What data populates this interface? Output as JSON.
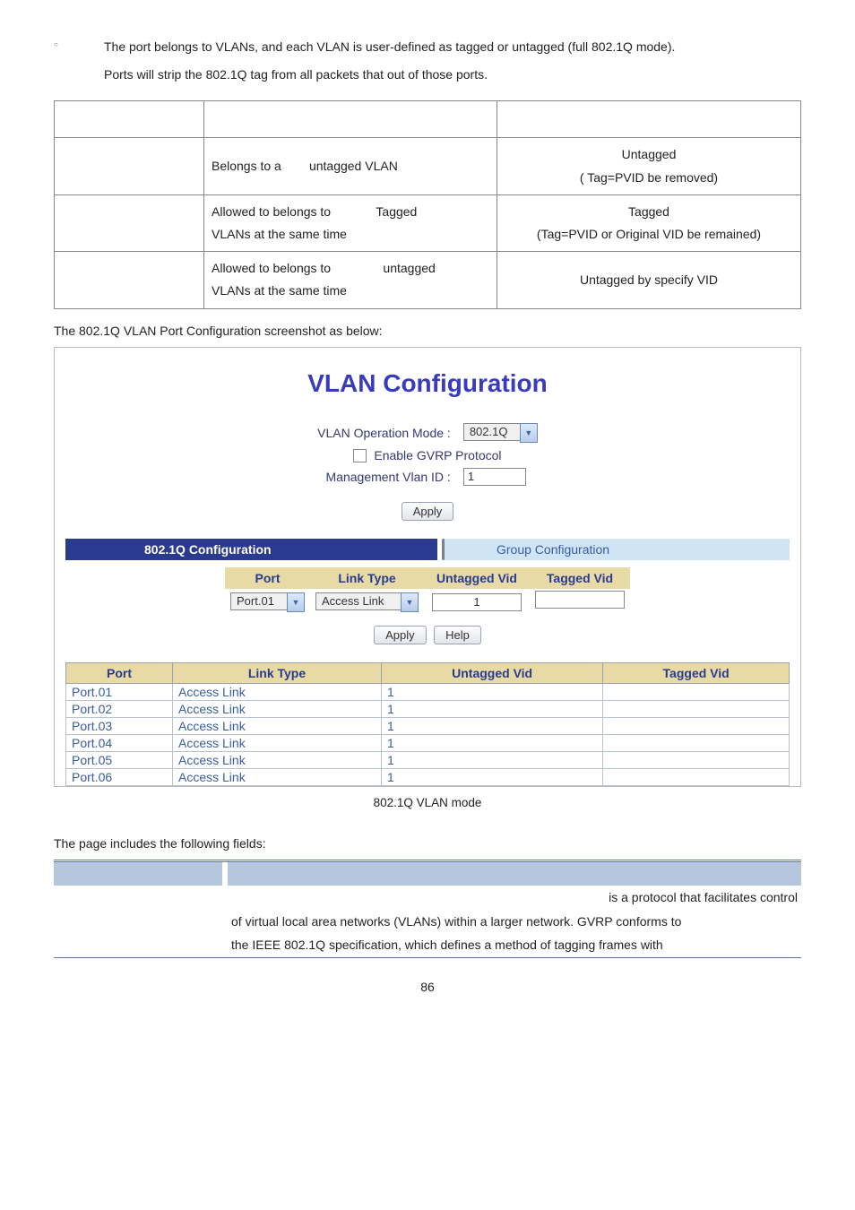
{
  "intro": {
    "line1": "The port belongs to VLANs, and each VLAN is user-defined as tagged or untagged (full 802.1Q mode).",
    "line2": "Ports will strip the 802.1Q tag from all packets that out of those ports."
  },
  "mode_table": {
    "rows": [
      {
        "c1": "",
        "c2": "Belongs to a        untagged VLAN",
        "c3a": "Untagged",
        "c3b": "( Tag=PVID be removed)"
      },
      {
        "c1": "",
        "c2a": "Allowed to belongs to             Tagged",
        "c2b": "VLANs at the same time",
        "c3a": "Tagged",
        "c3b": "(Tag=PVID or Original VID be remained)"
      },
      {
        "c1": "",
        "c2a": "Allowed to belongs to               untagged",
        "c2b": "VLANs at the same time",
        "c3": "Untagged by specify VID"
      }
    ]
  },
  "section1": "The 802.1Q VLAN Port Configuration screenshot as below:",
  "screenshot": {
    "title": "VLAN Configuration",
    "form": {
      "mode_label": "VLAN Operation Mode :",
      "mode_value": "802.1Q",
      "gvrp_label": "Enable GVRP Protocol",
      "mgmt_label": "Management Vlan ID :",
      "mgmt_value": "1",
      "apply": "Apply"
    },
    "tabs": {
      "active": "802.1Q Configuration",
      "inactive": "Group Configuration"
    },
    "config_headers": {
      "port": "Port",
      "link": "Link Type",
      "uvid": "Untagged Vid",
      "tvid": "Tagged Vid"
    },
    "config_values": {
      "port": "Port.01",
      "link": "Access Link",
      "uvid": "1"
    },
    "buttons": {
      "apply": "Apply",
      "help": "Help"
    },
    "list_headers": {
      "port": "Port",
      "link": "Link Type",
      "uvid": "Untagged Vid",
      "tvid": "Tagged Vid"
    },
    "list_rows": [
      {
        "port": "Port.01",
        "link": "Access Link",
        "uvid": "1",
        "tvid": ""
      },
      {
        "port": "Port.02",
        "link": "Access Link",
        "uvid": "1",
        "tvid": ""
      },
      {
        "port": "Port.03",
        "link": "Access Link",
        "uvid": "1",
        "tvid": ""
      },
      {
        "port": "Port.04",
        "link": "Access Link",
        "uvid": "1",
        "tvid": ""
      },
      {
        "port": "Port.05",
        "link": "Access Link",
        "uvid": "1",
        "tvid": ""
      },
      {
        "port": "Port.06",
        "link": "Access Link",
        "uvid": "1",
        "tvid": ""
      }
    ]
  },
  "caption": "802.1Q VLAN mode",
  "fields_heading": "The page includes the following fields:",
  "fields_desc": {
    "l1_tail": " is a protocol that facilitates control",
    "l2": "of virtual local area networks (VLANs) within a larger network. GVRP conforms to",
    "l3": "the IEEE 802.1Q specification, which defines a method of tagging frames with"
  },
  "page_number": "86"
}
